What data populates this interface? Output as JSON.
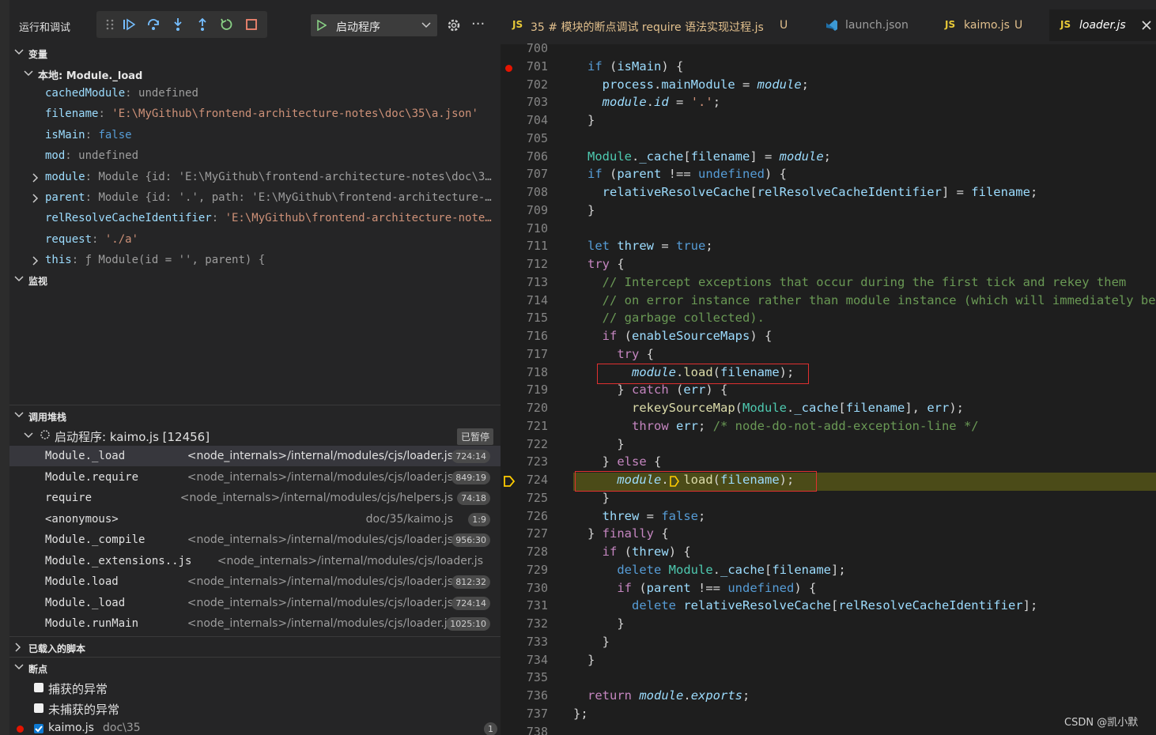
{
  "debug": {
    "title": "运行和调试",
    "launch_config": "启动程序"
  },
  "sections": {
    "variables": "变量",
    "watch": "监视",
    "callstack": "调用堆栈",
    "loaded_scripts": "已载入的脚本",
    "breakpoints": "断点"
  },
  "variables": {
    "scope": "本地: Module._load",
    "items": [
      {
        "name": "cachedModule",
        "value": "undefined",
        "kind": "gray",
        "expandable": false
      },
      {
        "name": "filename",
        "value": "'E:\\MyGithub\\frontend-architecture-notes\\doc\\35\\a.json'",
        "kind": "str",
        "expandable": false
      },
      {
        "name": "isMain",
        "value": "false",
        "kind": "kw",
        "expandable": false
      },
      {
        "name": "mod",
        "value": "undefined",
        "kind": "gray",
        "expandable": false
      },
      {
        "name": "module",
        "value": "Module {id: 'E:\\MyGithub\\frontend-architecture-notes\\doc\\3…",
        "kind": "obj",
        "expandable": true
      },
      {
        "name": "parent",
        "value": "Module {id: '.', path: 'E:\\MyGithub\\frontend-architecture-…",
        "kind": "obj",
        "expandable": true
      },
      {
        "name": "relResolveCacheIdentifier",
        "value": "'E:\\MyGithub\\frontend-architecture-note…",
        "kind": "str",
        "expandable": false
      },
      {
        "name": "request",
        "value": "'./a'",
        "kind": "str",
        "expandable": false
      },
      {
        "name": "this",
        "value": "ƒ Module(id = '', parent) {",
        "kind": "obj",
        "expandable": true
      }
    ]
  },
  "callstack": {
    "session": "启动程序: kaimo.js [12456]",
    "status": "已暂停",
    "frames": [
      {
        "fn": "Module._load",
        "src": "<node_internals>/internal/modules/cjs/loader.js",
        "pos": "724:14"
      },
      {
        "fn": "Module.require",
        "src": "<node_internals>/internal/modules/cjs/loader.js",
        "pos": "849:19"
      },
      {
        "fn": "require",
        "src": "<node_internals>/internal/modules/cjs/helpers.js",
        "pos": "74:18"
      },
      {
        "fn": "<anonymous>",
        "src": "doc/35/kaimo.js",
        "pos": "1:9"
      },
      {
        "fn": "Module._compile",
        "src": "<node_internals>/internal/modules/cjs/loader.js",
        "pos": "956:30"
      },
      {
        "fn": "Module._extensions..js",
        "src": "<node_internals>/internal/modules/cjs/loader.js",
        "pos": ""
      },
      {
        "fn": "Module.load",
        "src": "<node_internals>/internal/modules/cjs/loader.js",
        "pos": "812:32"
      },
      {
        "fn": "Module._load",
        "src": "<node_internals>/internal/modules/cjs/loader.js",
        "pos": "724:14"
      },
      {
        "fn": "Module.runMain",
        "src": "<node_internals>/internal/modules/cjs/loader.js",
        "pos": "1025:10"
      }
    ]
  },
  "breakpoints": {
    "caught": "捕获的异常",
    "uncaught": "未捕获的异常",
    "file": "kaimo.js",
    "file_dir": "doc\\35",
    "count": "1"
  },
  "tabs": [
    {
      "icon": "JS",
      "name": "35 # 模块的断点调试 require 语法实现过程.js",
      "status": "U"
    },
    {
      "icon": "vscode-icon",
      "name": "launch.json",
      "status": ""
    },
    {
      "icon": "JS",
      "name": "kaimo.js",
      "status": "U"
    },
    {
      "icon": "JS",
      "name": "loader.js",
      "status": ""
    }
  ],
  "editor": {
    "first_line": 700,
    "current_line": 724,
    "breakpoint_line": 701
  },
  "watermark": "CSDN @凯小默"
}
